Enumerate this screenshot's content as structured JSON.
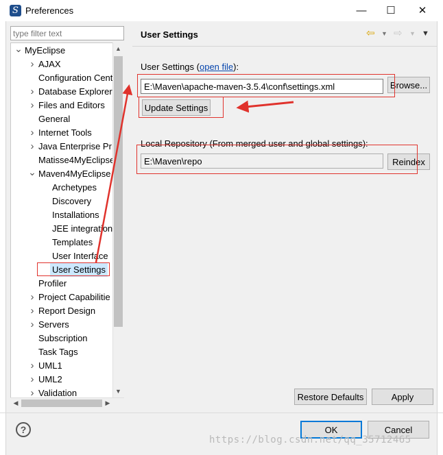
{
  "window": {
    "title": "Preferences",
    "app_icon_glyph": "S",
    "minimize_glyph": "—",
    "maximize_glyph": "☐",
    "close_glyph": "✕"
  },
  "filter": {
    "placeholder": "type filter text",
    "value": ""
  },
  "tree": {
    "rows": [
      {
        "label": "MyEclipse",
        "level": 0,
        "twisty": "expanded"
      },
      {
        "label": "AJAX",
        "level": 1,
        "twisty": "collapsed"
      },
      {
        "label": "Configuration Cent",
        "level": 1,
        "twisty": "none"
      },
      {
        "label": "Database Explorer",
        "level": 1,
        "twisty": "collapsed"
      },
      {
        "label": "Files and Editors",
        "level": 1,
        "twisty": "collapsed"
      },
      {
        "label": "General",
        "level": 1,
        "twisty": "none"
      },
      {
        "label": "Internet Tools",
        "level": 1,
        "twisty": "collapsed"
      },
      {
        "label": "Java Enterprise Pr",
        "level": 1,
        "twisty": "collapsed"
      },
      {
        "label": "Matisse4MyEclipse",
        "level": 1,
        "twisty": "none"
      },
      {
        "label": "Maven4MyEclipse",
        "level": 1,
        "twisty": "expanded"
      },
      {
        "label": "Archetypes",
        "level": 2,
        "twisty": "none"
      },
      {
        "label": "Discovery",
        "level": 2,
        "twisty": "none"
      },
      {
        "label": "Installations",
        "level": 2,
        "twisty": "none"
      },
      {
        "label": "JEE integration",
        "level": 2,
        "twisty": "none"
      },
      {
        "label": "Templates",
        "level": 2,
        "twisty": "none"
      },
      {
        "label": "User Interface",
        "level": 2,
        "twisty": "none"
      },
      {
        "label": "User Settings",
        "level": 2,
        "twisty": "none",
        "selected": true
      },
      {
        "label": "Profiler",
        "level": 1,
        "twisty": "none"
      },
      {
        "label": "Project Capabilitie",
        "level": 1,
        "twisty": "collapsed"
      },
      {
        "label": "Report Design",
        "level": 1,
        "twisty": "collapsed"
      },
      {
        "label": "Servers",
        "level": 1,
        "twisty": "collapsed"
      },
      {
        "label": "Subscription",
        "level": 1,
        "twisty": "none"
      },
      {
        "label": "Task Tags",
        "level": 1,
        "twisty": "none"
      },
      {
        "label": "UML1",
        "level": 1,
        "twisty": "collapsed"
      },
      {
        "label": "UML2",
        "level": 1,
        "twisty": "collapsed"
      },
      {
        "label": "Validation",
        "level": 1,
        "twisty": "collapsed"
      }
    ]
  },
  "panel": {
    "title": "User Settings",
    "user_settings_label": "User Settings (",
    "open_file_link": "open file",
    "user_settings_label_end": "):",
    "settings_path": "E:\\Maven\\apache-maven-3.5.4\\conf\\settings.xml",
    "browse_button": "Browse...",
    "update_button": "Update Settings",
    "local_repo_label": "Local Repository (From merged user and global settings):",
    "local_repo_path": "E:\\Maven\\repo",
    "reindex_button": "Reindex",
    "restore_defaults_button": "Restore Defaults",
    "apply_button": "Apply"
  },
  "footer": {
    "ok_button": "OK",
    "cancel_button": "Cancel",
    "help_glyph": "?"
  },
  "watermark": "https://blog.csdn.net/qq_35712465",
  "colors": {
    "selection": "#cce8ff",
    "annotation_red": "#e0322c",
    "link": "#0645ad",
    "primary_border": "#0078d7"
  }
}
